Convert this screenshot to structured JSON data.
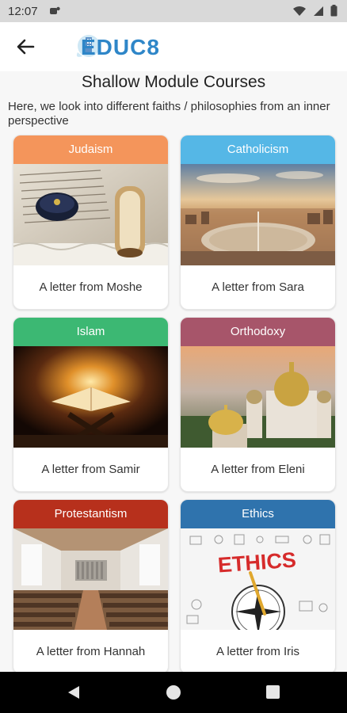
{
  "status_bar": {
    "time": "12:07"
  },
  "app_bar": {
    "logo_text": "EDUC8"
  },
  "page": {
    "title": "Shallow Module Courses",
    "subtitle": "Here, we look into different faiths / philosophies from an inner perspective"
  },
  "courses": [
    {
      "title": "Judaism",
      "caption": "A letter from Moshe",
      "color": "#f4955b"
    },
    {
      "title": "Catholicism",
      "caption": "A letter from Sara",
      "color": "#55b7e6"
    },
    {
      "title": "Islam",
      "caption": "A letter from Samir",
      "color": "#3cb873"
    },
    {
      "title": "Orthodoxy",
      "caption": "A letter from Eleni",
      "color": "#a7556a"
    },
    {
      "title": "Protestantism",
      "caption": "A letter from Hannah",
      "color": "#b7301c"
    },
    {
      "title": "Ethics",
      "caption": "A letter from Iris",
      "color": "#2f73ad"
    }
  ],
  "image_text": {
    "ethics": "ETHICS"
  }
}
